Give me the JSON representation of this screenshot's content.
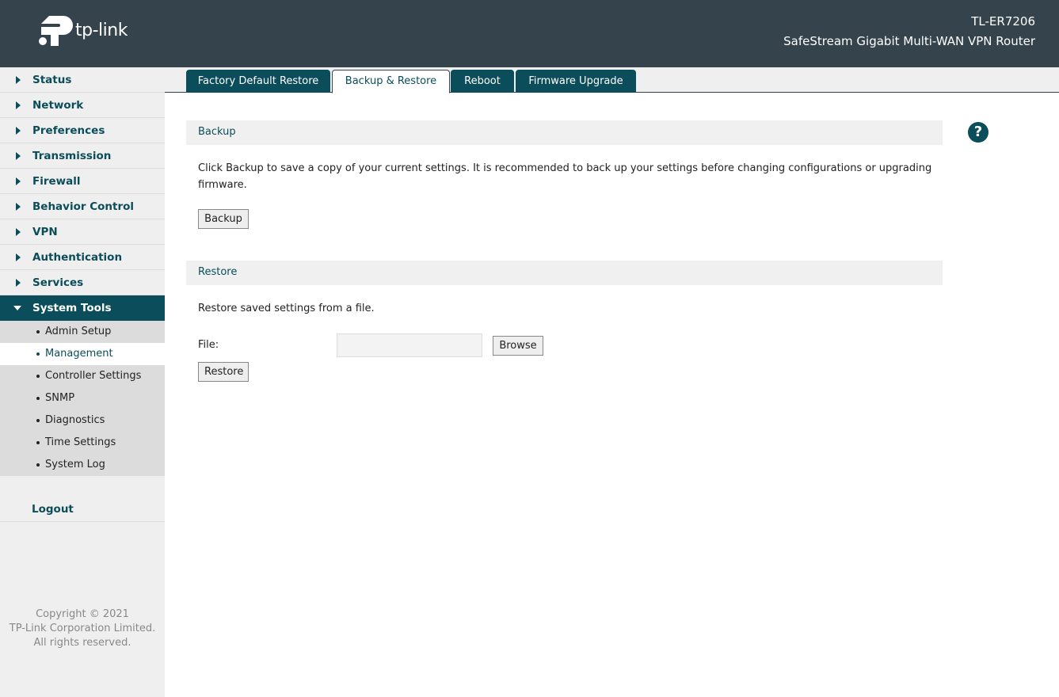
{
  "header": {
    "logo_text": "tp-link",
    "model": "TL-ER7206",
    "description": "SafeStream Gigabit Multi-WAN VPN Router"
  },
  "sidebar": {
    "items": [
      {
        "label": "Status"
      },
      {
        "label": "Network"
      },
      {
        "label": "Preferences"
      },
      {
        "label": "Transmission"
      },
      {
        "label": "Firewall"
      },
      {
        "label": "Behavior Control"
      },
      {
        "label": "VPN"
      },
      {
        "label": "Authentication"
      },
      {
        "label": "Services"
      },
      {
        "label": "System Tools"
      }
    ],
    "sub_items": [
      {
        "label": "Admin Setup"
      },
      {
        "label": "Management"
      },
      {
        "label": "Controller Settings"
      },
      {
        "label": "SNMP"
      },
      {
        "label": "Diagnostics"
      },
      {
        "label": "Time Settings"
      },
      {
        "label": "System Log"
      }
    ],
    "logout": "Logout",
    "copyright": [
      "Copyright © 2021",
      "TP-Link Corporation Limited.",
      "All rights reserved."
    ]
  },
  "tabs": [
    {
      "label": "Factory Default Restore"
    },
    {
      "label": "Backup & Restore"
    },
    {
      "label": "Reboot"
    },
    {
      "label": "Firmware Upgrade"
    }
  ],
  "backup": {
    "title": "Backup",
    "description": "Click Backup to save a copy of your current settings. It is recommended to back up your settings before changing configurations or upgrading firmware.",
    "button": "Backup"
  },
  "restore": {
    "title": "Restore",
    "description": "Restore saved settings from a file.",
    "file_label": "File:",
    "file_value": "",
    "browse_button": "Browse",
    "button": "Restore"
  },
  "help_icon": "?",
  "colors": {
    "header_bg": "#35444c",
    "accent": "#0b4d5a",
    "sidebar_bg": "#efefef"
  }
}
